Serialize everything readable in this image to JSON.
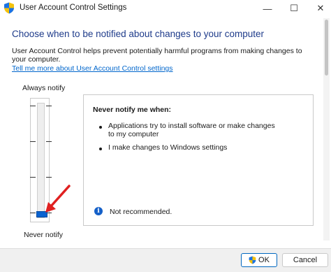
{
  "window": {
    "title": "User Account Control Settings",
    "minimize_glyph": "—",
    "maximize_glyph": "☐",
    "close_glyph": "✕"
  },
  "main": {
    "heading": "Choose when to be notified about changes to your computer",
    "description": "User Account Control helps prevent potentially harmful programs from making changes to your computer.",
    "learn_more_link": "Tell me more about User Account Control settings"
  },
  "slider": {
    "top_label": "Always notify",
    "bottom_label": "Never notify",
    "levels": 4,
    "selected_level": 1,
    "selected_level_name": "Never notify"
  },
  "panel": {
    "title": "Never notify me when:",
    "bullets": [
      "Applications try to install software or make changes to my computer",
      "I make changes to Windows settings"
    ],
    "info_text": "Not recommended."
  },
  "footer": {
    "ok_label": "OK",
    "cancel_label": "Cancel"
  },
  "colors": {
    "heading": "#1e3b8a",
    "link": "#0066cc",
    "slider_thumb": "#0a63d0",
    "arrow": "#e02020",
    "info_icon": "#1560c8"
  },
  "icons": {
    "app": "uac-shield-icon",
    "info": "info-icon",
    "ok": "uac-shield-icon"
  }
}
